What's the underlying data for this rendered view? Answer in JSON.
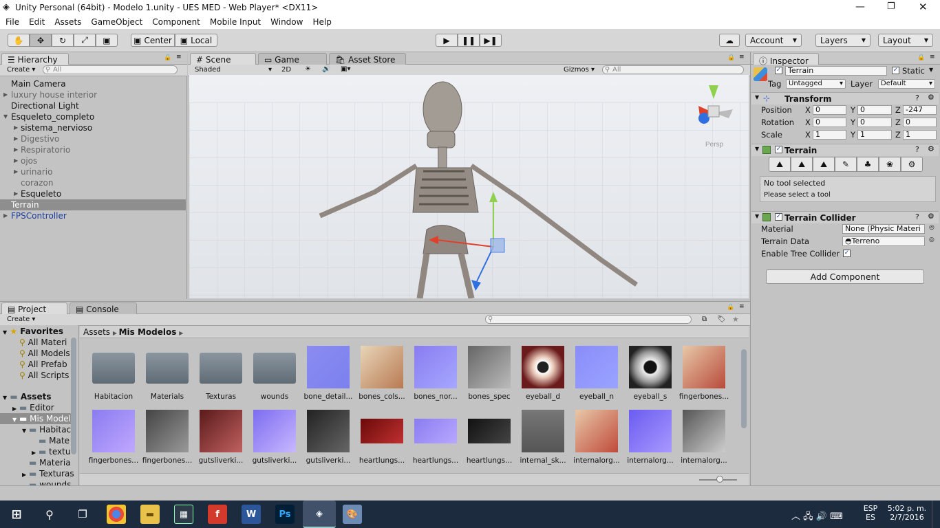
{
  "window": {
    "title": "Unity Personal (64bit) - Modelo 1.unity - UES MED - Web Player* <DX11>"
  },
  "menu": [
    "File",
    "Edit",
    "Assets",
    "GameObject",
    "Component",
    "Mobile Input",
    "Window",
    "Help"
  ],
  "toolbar": {
    "pivot": "Center",
    "space": "Local",
    "account": "Account",
    "layers": "Layers",
    "layout": "Layout"
  },
  "hierarchy": {
    "tab": "Hierarchy",
    "create": "Create",
    "search_placeholder": "All",
    "items": [
      {
        "label": "Main Camera"
      },
      {
        "label": "luxury house interior"
      },
      {
        "label": "Directional Light"
      },
      {
        "label": "Esqueleto_completo"
      },
      {
        "label": "sistema_nervioso"
      },
      {
        "label": "Digestivo"
      },
      {
        "label": "Respiratorio"
      },
      {
        "label": "ojos"
      },
      {
        "label": "urinario"
      },
      {
        "label": "corazon"
      },
      {
        "label": "Esqueleto"
      },
      {
        "label": "Terrain"
      },
      {
        "label": "FPSController"
      }
    ]
  },
  "scene": {
    "tabs": [
      "Scene",
      "Game",
      "Asset Store"
    ],
    "shading": "Shaded",
    "mode2d": "2D",
    "gizmos": "Gizmos",
    "search_placeholder": "All",
    "persp": "Persp"
  },
  "inspector": {
    "tab": "Inspector",
    "object_name": "Terrain",
    "static_label": "Static",
    "tag_label": "Tag",
    "tag_value": "Untagged",
    "layer_label": "Layer",
    "layer_value": "Default",
    "transform": {
      "title": "Transform",
      "position_label": "Position",
      "rotation_label": "Rotation",
      "scale_label": "Scale",
      "position": [
        "0",
        "0",
        "-247"
      ],
      "rotation": [
        "0",
        "0",
        "0"
      ],
      "scale": [
        "1",
        "1",
        "1"
      ],
      "axis": [
        "X",
        "Y",
        "Z"
      ]
    },
    "terrain": {
      "title": "Terrain",
      "no_tool": "No tool selected",
      "select_tool": "Please select a tool"
    },
    "collider": {
      "title": "Terrain Collider",
      "material_label": "Material",
      "material_value": "None (Physic Materi",
      "data_label": "Terrain Data",
      "data_value": "Terreno",
      "tree_label": "Enable Tree Collider"
    },
    "add_component": "Add Component"
  },
  "project": {
    "tabs": [
      "Project",
      "Console"
    ],
    "create": "Create",
    "breadcrumb": [
      "Assets",
      "Mis Modelos"
    ],
    "favorites": {
      "title": "Favorites",
      "items": [
        "All Materi",
        "All Models",
        "All Prefab",
        "All Scripts"
      ]
    },
    "tree": {
      "root": "Assets",
      "items": [
        "Editor",
        "Mis Model",
        "Habitac",
        "Mate",
        "textu",
        "Materia",
        "Texturas",
        "wounds"
      ]
    },
    "assets": [
      {
        "name": "Habitacion"
      },
      {
        "name": "Materials"
      },
      {
        "name": "Texturas"
      },
      {
        "name": "wounds"
      },
      {
        "name": "bone_detail..."
      },
      {
        "name": "bones_cols..."
      },
      {
        "name": "bones_nor..."
      },
      {
        "name": "bones_spec"
      },
      {
        "name": "eyeball_d"
      },
      {
        "name": "eyeball_n"
      },
      {
        "name": "eyeball_s"
      },
      {
        "name": "fingerbones..."
      },
      {
        "name": "fingerbones..."
      },
      {
        "name": "fingerbones..."
      },
      {
        "name": "gutsliverki..."
      },
      {
        "name": "gutsliverki..."
      },
      {
        "name": "gutsliverki..."
      },
      {
        "name": "heartlungs..."
      },
      {
        "name": "heartlungs..."
      },
      {
        "name": "heartlungs..."
      },
      {
        "name": "internal_sk..."
      },
      {
        "name": "internalorg..."
      },
      {
        "name": "internalorg..."
      },
      {
        "name": "internalorg..."
      }
    ]
  },
  "taskbar": {
    "lang1": "ESP",
    "lang2": "ES",
    "time": "5:02 p. m.",
    "date": "2/7/2016"
  }
}
